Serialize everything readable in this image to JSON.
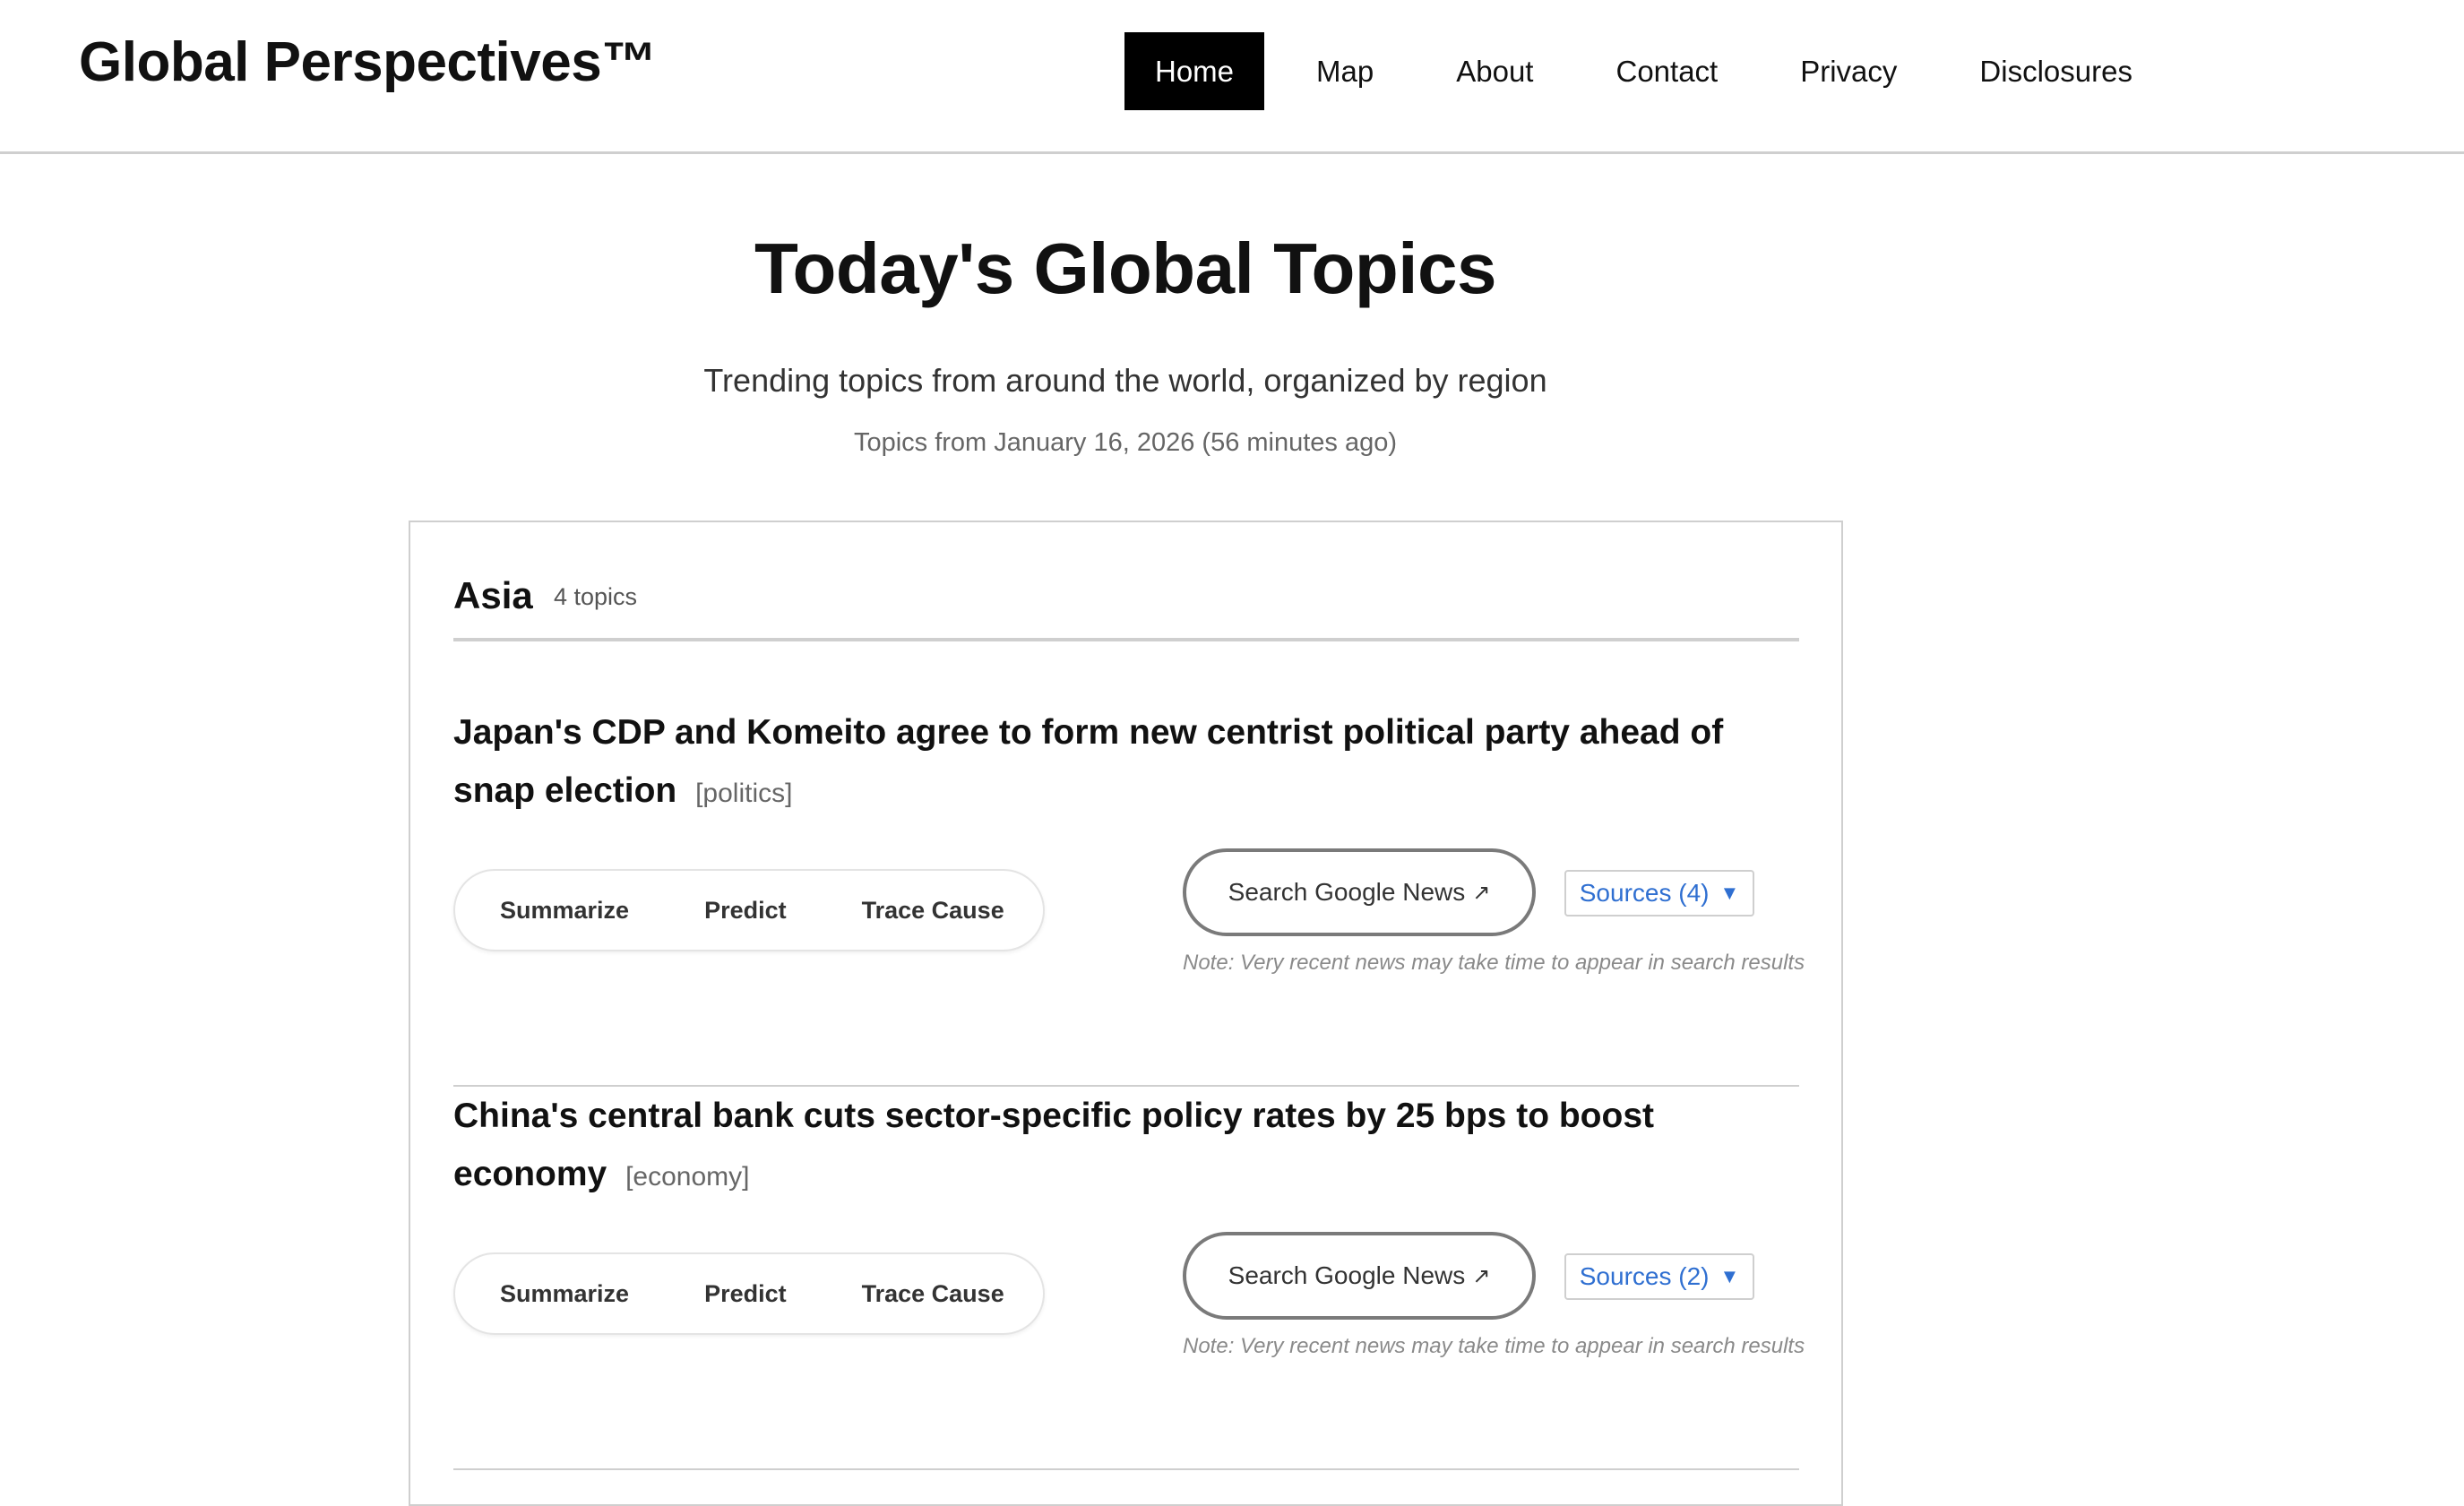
{
  "header": {
    "brand": "Global Perspectives™",
    "nav": [
      {
        "label": "Home",
        "active": true
      },
      {
        "label": "Map",
        "active": false
      },
      {
        "label": "About",
        "active": false
      },
      {
        "label": "Contact",
        "active": false
      },
      {
        "label": "Privacy",
        "active": false
      },
      {
        "label": "Disclosures",
        "active": false
      }
    ]
  },
  "intro": {
    "title": "Today's Global Topics",
    "subtitle": "Trending topics from around the world, organized by region",
    "timestamp": "Topics from January 16, 2026 (56 minutes ago)"
  },
  "region": {
    "name": "Asia",
    "count": "4 topics",
    "topics": [
      {
        "title": "Japan's CDP and Komeito agree to form new centrist political party ahead of snap election",
        "tag": "[politics]",
        "actions": [
          "Summarize",
          "Predict",
          "Trace Cause"
        ],
        "search_label": "Search Google News",
        "search_arrow": "↗",
        "sources_label": "Sources (4)",
        "sources_caret": "▼",
        "note": "Note: Very recent news may take time to appear in search results"
      },
      {
        "title": "China's central bank cuts sector-specific policy rates by 25 bps to boost economy",
        "tag": "[economy]",
        "actions": [
          "Summarize",
          "Predict",
          "Trace Cause"
        ],
        "search_label": "Search Google News",
        "search_arrow": "↗",
        "sources_label": "Sources (2)",
        "sources_caret": "▼",
        "note": "Note: Very recent news may take time to appear in search results"
      }
    ]
  },
  "colors": {
    "accent_link": "#2f6fd1",
    "nav_active_bg": "#000000",
    "divider": "#cfcfcf"
  }
}
